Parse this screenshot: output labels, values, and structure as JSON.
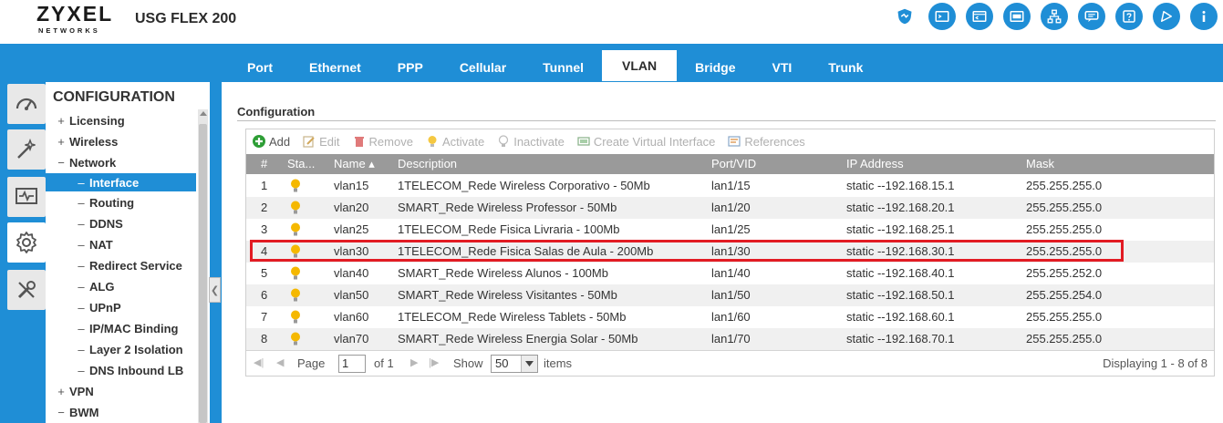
{
  "header": {
    "logo_main": "ZYXEL",
    "logo_sub": "NETWORKS",
    "model": "USG FLEX 200",
    "icons": [
      "shield-icon",
      "console-icon",
      "cli-icon",
      "window-icon",
      "sitemap-icon",
      "chat-icon",
      "help-icon",
      "nebula-icon",
      "info-icon"
    ]
  },
  "tabs": [
    {
      "label": "Port"
    },
    {
      "label": "Ethernet"
    },
    {
      "label": "PPP"
    },
    {
      "label": "Cellular"
    },
    {
      "label": "Tunnel"
    },
    {
      "label": "VLAN",
      "active": true
    },
    {
      "label": "Bridge"
    },
    {
      "label": "VTI"
    },
    {
      "label": "Trunk"
    }
  ],
  "sidebar": {
    "title": "CONFIGURATION",
    "icons": [
      "dashboard-icon",
      "monitor-wand-icon",
      "monitor-icon",
      "settings-gear-icon",
      "maintenance-tools-icon"
    ],
    "items": [
      {
        "sym": "+",
        "label": "Licensing",
        "level": 1
      },
      {
        "sym": "+",
        "label": "Wireless",
        "level": 1
      },
      {
        "sym": "−",
        "label": "Network",
        "level": 1
      },
      {
        "sym": "–",
        "label": "Interface",
        "level": 2,
        "active": true
      },
      {
        "sym": "–",
        "label": "Routing",
        "level": 2
      },
      {
        "sym": "–",
        "label": "DDNS",
        "level": 2
      },
      {
        "sym": "–",
        "label": "NAT",
        "level": 2
      },
      {
        "sym": "–",
        "label": "Redirect Service",
        "level": 2
      },
      {
        "sym": "–",
        "label": "ALG",
        "level": 2
      },
      {
        "sym": "–",
        "label": "UPnP",
        "level": 2
      },
      {
        "sym": "–",
        "label": "IP/MAC Binding",
        "level": 2
      },
      {
        "sym": "–",
        "label": "Layer 2 Isolation",
        "level": 2
      },
      {
        "sym": "–",
        "label": "DNS Inbound LB",
        "level": 2
      },
      {
        "sym": "+",
        "label": "VPN",
        "level": 1
      },
      {
        "sym": "−",
        "label": "BWM",
        "level": 1
      }
    ]
  },
  "main": {
    "section_title": "Configuration",
    "toolbar": {
      "add": "Add",
      "edit": "Edit",
      "remove": "Remove",
      "activate": "Activate",
      "inactivate": "Inactivate",
      "create_virtual": "Create Virtual Interface",
      "references": "References"
    },
    "columns": {
      "num": "#",
      "status": "Sta...",
      "name": "Name ▴",
      "description": "Description",
      "port": "Port/VID",
      "ip": "IP Address",
      "mask": "Mask"
    },
    "rows": [
      {
        "num": "1",
        "name": "vlan15",
        "description": "1TELECOM_Rede Wireless Corporativo - 50Mb",
        "port": "lan1/15",
        "ip": "static --192.168.15.1",
        "mask": "255.255.255.0"
      },
      {
        "num": "2",
        "name": "vlan20",
        "description": "SMART_Rede Wireless Professor - 50Mb",
        "port": "lan1/20",
        "ip": "static --192.168.20.1",
        "mask": "255.255.255.0"
      },
      {
        "num": "3",
        "name": "vlan25",
        "description": "1TELECOM_Rede Fisica Livraria - 100Mb",
        "port": "lan1/25",
        "ip": "static --192.168.25.1",
        "mask": "255.255.255.0"
      },
      {
        "num": "4",
        "name": "vlan30",
        "description": "1TELECOM_Rede Fisica Salas de Aula - 200Mb",
        "port": "lan1/30",
        "ip": "static --192.168.30.1",
        "mask": "255.255.255.0"
      },
      {
        "num": "5",
        "name": "vlan40",
        "description": "SMART_Rede Wireless Alunos - 100Mb",
        "port": "lan1/40",
        "ip": "static --192.168.40.1",
        "mask": "255.255.252.0"
      },
      {
        "num": "6",
        "name": "vlan50",
        "description": "SMART_Rede Wireless Visitantes - 50Mb",
        "port": "lan1/50",
        "ip": "static --192.168.50.1",
        "mask": "255.255.254.0"
      },
      {
        "num": "7",
        "name": "vlan60",
        "description": "1TELECOM_Rede Wireless Tablets - 50Mb",
        "port": "lan1/60",
        "ip": "static --192.168.60.1",
        "mask": "255.255.255.0"
      },
      {
        "num": "8",
        "name": "vlan70",
        "description": "SMART_Rede Wireless Energia Solar - 50Mb",
        "port": "lan1/70",
        "ip": "static --192.168.70.1",
        "mask": "255.255.255.0"
      }
    ],
    "footer": {
      "page_label": "Page",
      "page_value": "1",
      "of_label": "of 1",
      "show_label": "Show",
      "show_value": "50",
      "items_label": "items",
      "displaying": "Displaying 1 - 8 of 8"
    }
  },
  "colors": {
    "brand_blue": "#1f8ed6",
    "header_gray": "#9a9a9a",
    "highlight_red": "#e21b23",
    "bulb_yellow": "#f5b800"
  }
}
